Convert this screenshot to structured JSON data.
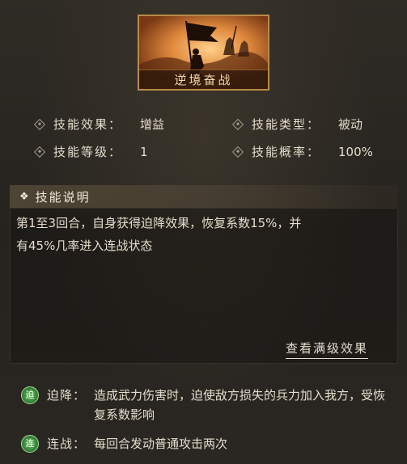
{
  "skill": {
    "name": "逆境奋战",
    "badge_icon": "flag-bearer-artwork"
  },
  "attributes": {
    "effect_label": "技能效果：",
    "effect_value": "增益",
    "type_label": "技能类型：",
    "type_value": "被动",
    "level_label": "技能等级：",
    "level_value": "1",
    "chance_label": "技能概率：",
    "chance_value": "100%"
  },
  "description": {
    "header": "技能说明",
    "header_icon": "clover-icon",
    "line1": "第1至3回合，自身获得迫降效果，恢复系数15%，并",
    "line2": "有45%几率进入连战状态",
    "full_effect_link": "查看满级效果"
  },
  "effects": [
    {
      "badge": "迫",
      "name": "迫降：",
      "desc": "造成武力伤害时，迫使敌方损失的兵力加入我方，受恢复系数影响"
    },
    {
      "badge": "连",
      "name": "连战：",
      "desc": "每回合发动普通攻击两次"
    }
  ],
  "colors": {
    "accent_gold": "#b88a4a",
    "badge_green": "#2d7a32",
    "text": "#e4dccc"
  }
}
